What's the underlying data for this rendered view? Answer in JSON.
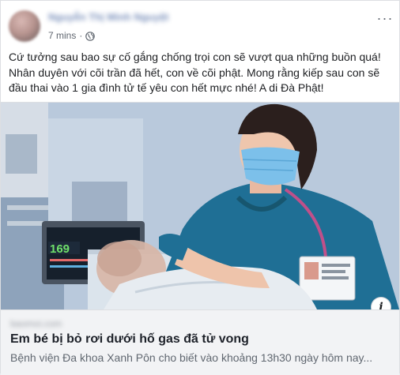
{
  "post": {
    "author": "Nguyễn Thị Minh Nguyệt",
    "time": "7 mins",
    "separator": "·",
    "privacy_icon": "globe-icon",
    "more_icon": "more-horizontal-icon",
    "text": "Cứ tưởng sau bao sự cố gắng chống trọi con sẽ vượt qua những buồn quá! Nhân duyên với cõi trần đã hết, con về cõi phật. Mong rằng kiếp sau con sẽ đầu thai vào 1 gia đình tử tế yêu con hết mực nhé! A di Đà Phật!"
  },
  "attachment": {
    "domain": "baomoi.com",
    "title": "Em bé bị bỏ rơi dưới hố gas đã tử vong",
    "description": "Bệnh viện Đa khoa Xanh Pôn cho biết vào khoảng 13h30 ngày hôm nay...",
    "info_icon": "info-icon",
    "info_glyph": "i",
    "monitor_reading": "169"
  },
  "colors": {
    "link": "#385898",
    "secondary_text": "#606770",
    "caption_bg": "#f2f3f5",
    "scrubs": "#1d6a8f",
    "mask": "#6fb6e4"
  }
}
